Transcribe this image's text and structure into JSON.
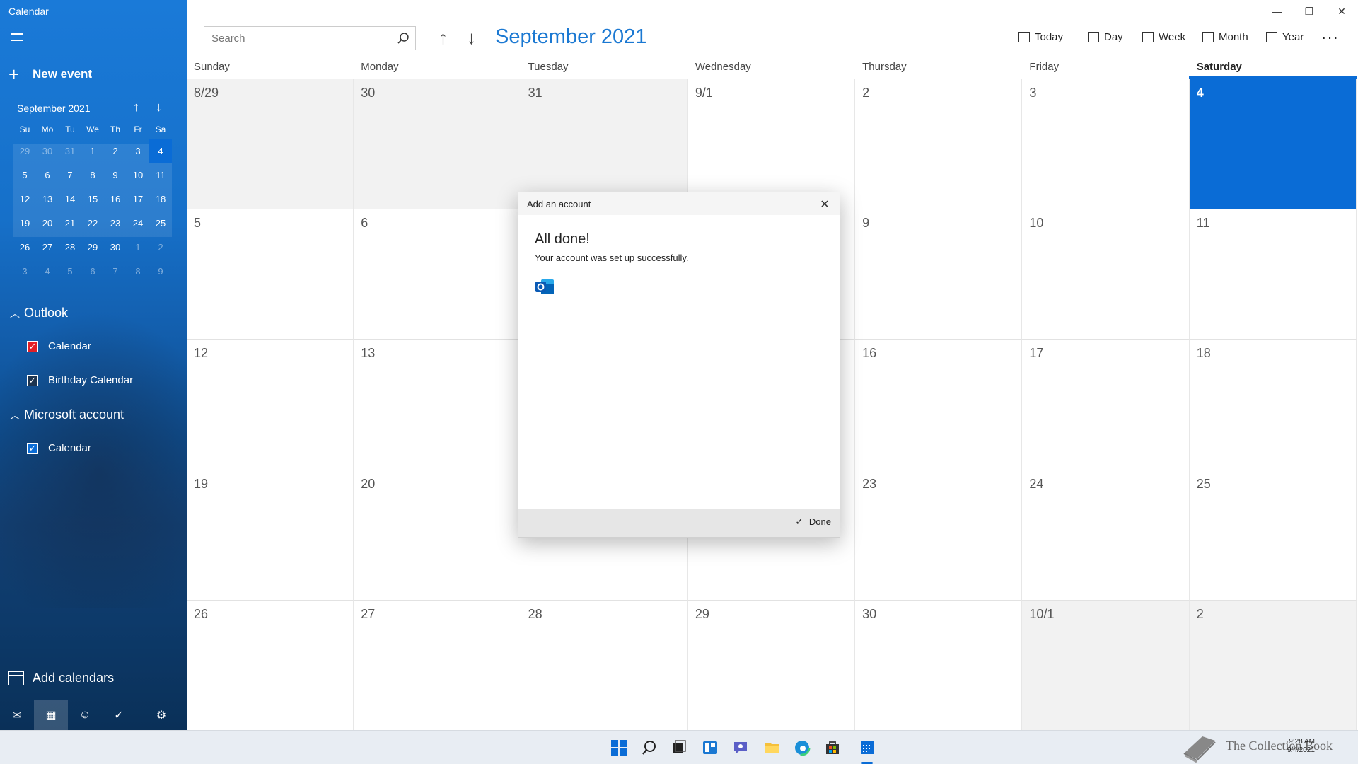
{
  "app": {
    "title": "Calendar"
  },
  "sidebar": {
    "new_event": "New event",
    "mini_month": "September 2021",
    "dow": [
      "Su",
      "Mo",
      "Tu",
      "We",
      "Th",
      "Fr",
      "Sa"
    ],
    "weeks": [
      [
        "29",
        "30",
        "31",
        "1",
        "2",
        "3",
        "4"
      ],
      [
        "5",
        "6",
        "7",
        "8",
        "9",
        "10",
        "11"
      ],
      [
        "12",
        "13",
        "14",
        "15",
        "16",
        "17",
        "18"
      ],
      [
        "19",
        "20",
        "21",
        "22",
        "23",
        "24",
        "25"
      ],
      [
        "26",
        "27",
        "28",
        "29",
        "30",
        "1",
        "2"
      ],
      [
        "3",
        "4",
        "5",
        "6",
        "7",
        "8",
        "9"
      ]
    ],
    "groups": [
      {
        "name": "Outlook",
        "calendars": [
          {
            "label": "Calendar",
            "color": "#e21f26"
          },
          {
            "label": "Birthday Calendar",
            "color": "#1e3550"
          }
        ]
      },
      {
        "name": "Microsoft account",
        "calendars": [
          {
            "label": "Calendar",
            "color": "#0a6cd6"
          }
        ]
      }
    ],
    "add_calendars": "Add calendars",
    "bottom_icons": [
      "mail-icon",
      "calendar-icon",
      "people-icon",
      "todo-icon",
      "gear-icon"
    ]
  },
  "search": {
    "placeholder": "Search"
  },
  "header": {
    "month_title": "September 2021"
  },
  "toolbar": {
    "today": "Today",
    "day": "Day",
    "week": "Week",
    "month": "Month",
    "year": "Year",
    "more": "···"
  },
  "calendar": {
    "dow": [
      "Sunday",
      "Monday",
      "Tuesday",
      "Wednesday",
      "Thursday",
      "Friday",
      "Saturday"
    ],
    "weeks": [
      [
        "8/29",
        "30",
        "31",
        "9/1",
        "2",
        "3",
        "4"
      ],
      [
        "5",
        "6",
        "",
        "",
        "9",
        "10",
        "11"
      ],
      [
        "12",
        "13",
        "",
        "",
        "16",
        "17",
        "18"
      ],
      [
        "19",
        "20",
        "",
        "",
        "23",
        "24",
        "25"
      ],
      [
        "26",
        "27",
        "28",
        "29",
        "30",
        "10/1",
        "2"
      ]
    ],
    "accent": "#0a6cd6"
  },
  "dialog": {
    "title": "Add an account",
    "heading": "All done!",
    "message": "Your account was set up successfully.",
    "done_label": "Done"
  },
  "taskbar": {
    "time": "9:28 AM",
    "date": "9/4/2021",
    "watermark": "The Collection Book",
    "icons": [
      "windows-start-icon",
      "search-icon",
      "task-view-icon",
      "widgets-icon",
      "chat-icon",
      "file-explorer-icon",
      "edge-icon",
      "store-icon",
      "calendar-app-icon"
    ]
  }
}
